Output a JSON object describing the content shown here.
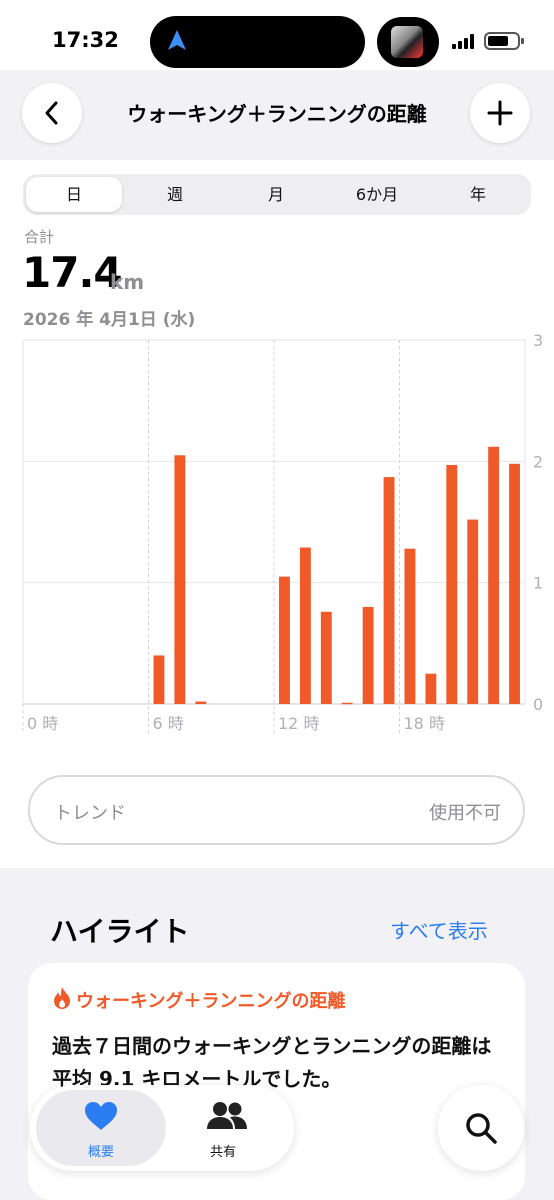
{
  "status": {
    "time": "17:32"
  },
  "nav": {
    "title": "ウォーキング＋ランニングの距離"
  },
  "segments": [
    {
      "label": "日",
      "active": true
    },
    {
      "label": "週",
      "active": false
    },
    {
      "label": "月",
      "active": false
    },
    {
      "label": "6か月",
      "active": false
    },
    {
      "label": "年",
      "active": false
    }
  ],
  "summary": {
    "total_label": "合計",
    "total_value": "17.4",
    "unit": "km",
    "date": "2026 年 4月1日 (水)"
  },
  "chart_data": {
    "type": "bar",
    "x_tick_labels": [
      "0 時",
      "6 時",
      "12 時",
      "18 時"
    ],
    "x_tick_hours": [
      0,
      6,
      12,
      18
    ],
    "y_tick_labels": [
      "3",
      "2",
      "1",
      "0"
    ],
    "ylim": [
      0,
      3
    ],
    "bar_color": "#f05a28",
    "grid": true,
    "categories": [
      "0",
      "1",
      "2",
      "3",
      "4",
      "5",
      "6",
      "7",
      "8",
      "9",
      "10",
      "11",
      "12",
      "13",
      "14",
      "15",
      "16",
      "17",
      "18",
      "19",
      "20",
      "21",
      "22",
      "23"
    ],
    "values": [
      0,
      0,
      0,
      0,
      0,
      0,
      0.4,
      2.05,
      0.02,
      0,
      0,
      0,
      1.05,
      1.29,
      0.76,
      0.01,
      0.8,
      1.87,
      1.28,
      0.25,
      1.97,
      1.52,
      2.12,
      1.98
    ]
  },
  "trend": {
    "label": "トレンド",
    "value": "使用不可"
  },
  "highlights": {
    "title": "ハイライト",
    "show_all": "すべて表示",
    "card_title": "ウォーキング＋ランニングの距離",
    "card_text": "過去７日間のウォーキングとランニングの距離は平均 9.1 キロメートルでした。"
  },
  "tabbar": {
    "summary_label": "概要",
    "sharing_label": "共有"
  },
  "colors": {
    "accent": "#f05a28",
    "link": "#2b7df1",
    "tab_active": "#2b7df1"
  }
}
